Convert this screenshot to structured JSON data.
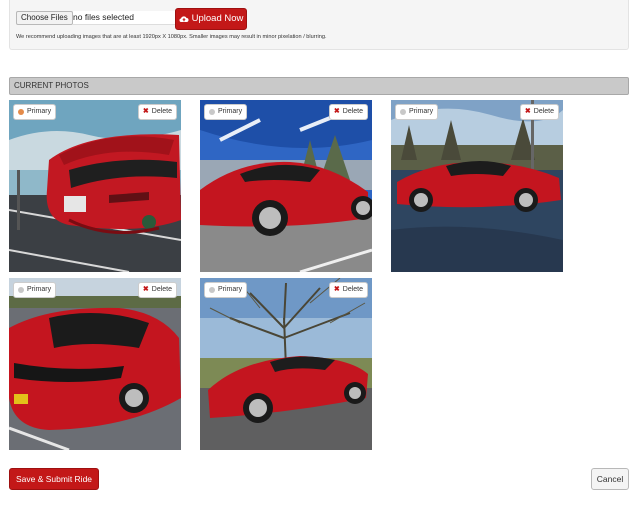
{
  "upload": {
    "choose_label": "Choose Files",
    "file_status": "no files selected",
    "upload_label": "Upload Now",
    "recommendation": "We recommend uploading images that are at least 1920px X 1080px. Smaller images may result in minor pixelation / blurring."
  },
  "section": {
    "title": "CURRENT PHOTOS"
  },
  "photos": [
    {
      "primary_label": "Primary",
      "delete_label": "Delete",
      "is_primary": true
    },
    {
      "primary_label": "Primary",
      "delete_label": "Delete",
      "is_primary": false
    },
    {
      "primary_label": "Primary",
      "delete_label": "Delete",
      "is_primary": false
    },
    {
      "primary_label": "Primary",
      "delete_label": "Delete",
      "is_primary": false
    },
    {
      "primary_label": "Primary",
      "delete_label": "Delete",
      "is_primary": false
    }
  ],
  "actions": {
    "save_label": "Save & Submit Ride",
    "cancel_label": "Cancel"
  },
  "colors": {
    "accent": "#c31818",
    "primary_dot_active": "#e48b4a",
    "primary_dot_inactive": "#c8c8c8",
    "header_bg": "#c9c9c9"
  },
  "icons": {
    "upload": "cloud-upload-icon",
    "delete": "x-icon",
    "primary": "dot-icon"
  }
}
